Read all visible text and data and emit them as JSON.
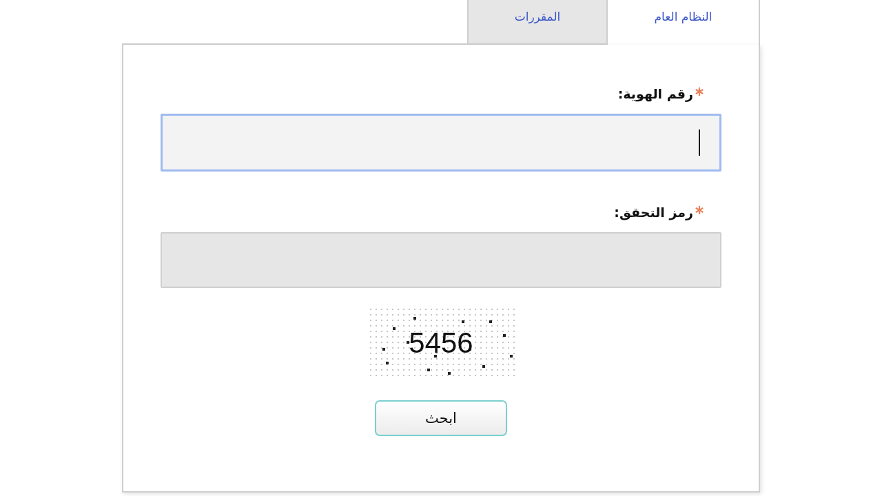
{
  "tabs": [
    {
      "label": "النظام العام",
      "selected": true
    },
    {
      "label": "المقررات",
      "selected": false
    }
  ],
  "form": {
    "fields": [
      {
        "label": "رقم الهوية:",
        "required": true,
        "focused": true
      },
      {
        "label": "رمز التحقق:",
        "required": true,
        "focused": false
      }
    ],
    "captcha": {
      "code": "5456"
    },
    "submit": "ابحث"
  }
}
